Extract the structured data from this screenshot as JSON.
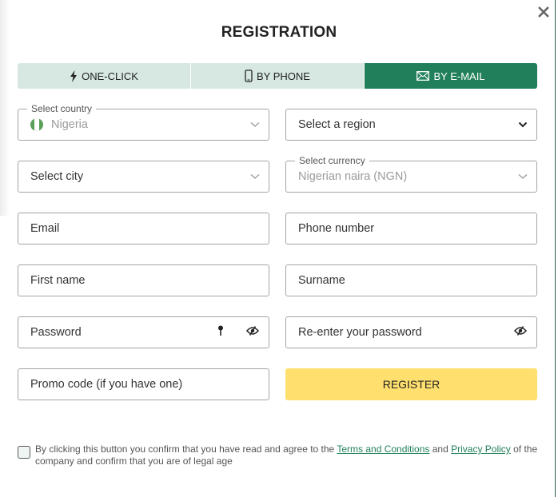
{
  "dialog": {
    "title": "REGISTRATION",
    "close_icon": "close-icon"
  },
  "tabs": [
    {
      "label": "ONE-CLICK",
      "icon": "lightning-icon",
      "active": false
    },
    {
      "label": "BY PHONE",
      "icon": "phone-icon",
      "active": false
    },
    {
      "label": "BY E-MAIL",
      "icon": "envelope-icon",
      "active": true
    }
  ],
  "form": {
    "country": {
      "legend": "Select country",
      "value": "Nigeria",
      "flag_icon": "nigeria-flag-icon"
    },
    "region": {
      "placeholder": "Select a region"
    },
    "city": {
      "placeholder": "Select city"
    },
    "currency": {
      "legend": "Select currency",
      "value": "Nigerian naira (NGN)"
    },
    "email": {
      "placeholder": "Email"
    },
    "phone": {
      "placeholder": "Phone number"
    },
    "first_name": {
      "placeholder": "First name"
    },
    "surname": {
      "placeholder": "Surname"
    },
    "password": {
      "placeholder": "Password"
    },
    "password_confirm": {
      "placeholder": "Re-enter your password"
    },
    "promo": {
      "placeholder": "Promo code (if you have one)"
    },
    "register_label": "REGISTER"
  },
  "consent": {
    "text_before": "By clicking this button you confirm that you have read and agree to the ",
    "terms_link": "Terms and Conditions",
    "text_mid": " and ",
    "privacy_link": "Privacy Policy",
    "text_after": " of the company and confirm that you are of legal age",
    "checked": false
  },
  "colors": {
    "accent_green": "#21805b",
    "tab_inactive_bg": "#d6e8e1",
    "register_yellow": "#ffe06e",
    "flag_green": "#5aa05a"
  }
}
